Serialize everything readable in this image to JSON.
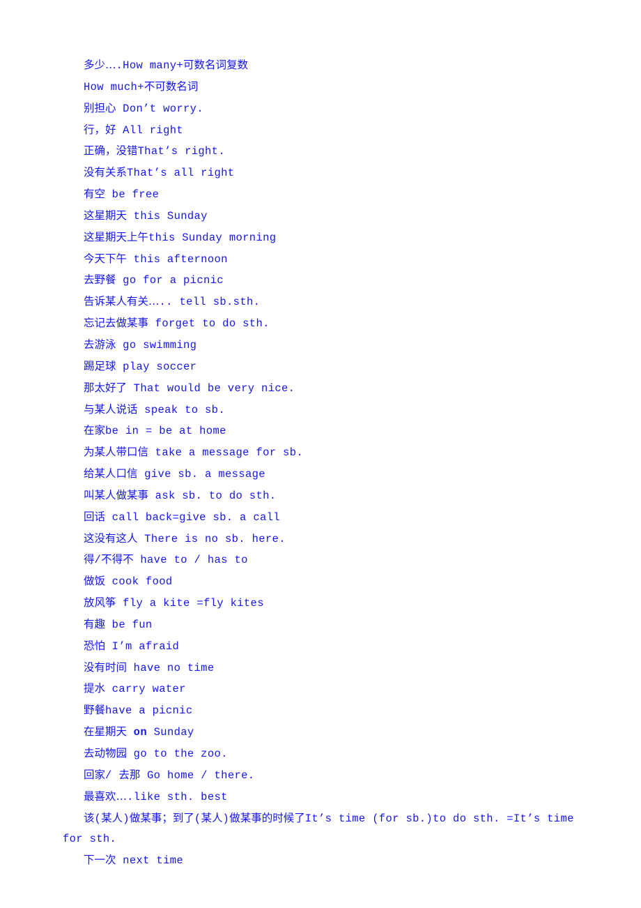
{
  "document": {
    "text_color": "#1616f0",
    "background_color": "#ffffff",
    "lines": [
      {
        "id": "line-1",
        "text": "多少….How many+可数名词复数",
        "indent": true
      },
      {
        "id": "line-2",
        "text": "How much+不可数名词",
        "indent": true
      },
      {
        "id": "line-3",
        "text": "别担心 Don’t worry.",
        "indent": true
      },
      {
        "id": "line-4",
        "text": "行，好  All right",
        "indent": true
      },
      {
        "id": "line-5",
        "text": "正确，没错That’s right.",
        "indent": true
      },
      {
        "id": "line-6",
        "text": "没有关系That’s all right",
        "indent": true
      },
      {
        "id": "line-7",
        "text": "有空  be free",
        "indent": true
      },
      {
        "id": "line-8",
        "text": "这星期天  this Sunday",
        "indent": true
      },
      {
        "id": "line-9",
        "text": "这星期天上午this Sunday morning",
        "indent": true
      },
      {
        "id": "line-10",
        "text": "今天下午 this afternoon",
        "indent": true
      },
      {
        "id": "line-11",
        "text": "去野餐  go for a picnic",
        "indent": true
      },
      {
        "id": "line-12",
        "text": "告诉某人有关….. tell sb.sth.",
        "indent": true
      },
      {
        "id": "line-13",
        "text": "忘记去做某事 forget to do sth.",
        "indent": true
      },
      {
        "id": "line-14",
        "text": "去游泳  go swimming",
        "indent": true
      },
      {
        "id": "line-15",
        "text": "踢足球 play soccer",
        "indent": true
      },
      {
        "id": "line-16",
        "text": "那太好了  That would be very nice.",
        "indent": true
      },
      {
        "id": "line-17",
        "text": "与某人说话  speak to sb.",
        "indent": true
      },
      {
        "id": "line-18",
        "text": "在家be in = be at home",
        "indent": true
      },
      {
        "id": "line-19",
        "text": "为某人带口信 take a message for sb.",
        "indent": true
      },
      {
        "id": "line-20",
        "text": "给某人口信  give sb. a message",
        "indent": true
      },
      {
        "id": "line-21",
        "text": "叫某人做某事 ask sb. to do sth.",
        "indent": true
      },
      {
        "id": "line-22",
        "text": "回话 call back=give sb. a call",
        "indent": true
      },
      {
        "id": "line-23",
        "text": "这没有这人 There is no sb. here.",
        "indent": true
      },
      {
        "id": "line-24",
        "text": "得/不得不 have to / has to",
        "indent": true
      },
      {
        "id": "line-25",
        "text": "做饭 cook food",
        "indent": true
      },
      {
        "id": "line-26",
        "text": "放风筝  fly a kite =fly kites",
        "indent": true
      },
      {
        "id": "line-27",
        "text": "有趣 be fun",
        "indent": true
      },
      {
        "id": "line-28",
        "text": "恐怕 I’m afraid",
        "indent": true
      },
      {
        "id": "line-29",
        "text": "没有时间  have no time",
        "indent": true
      },
      {
        "id": "line-30",
        "text": "提水 carry water",
        "indent": true
      },
      {
        "id": "line-31",
        "text": "野餐have a picnic",
        "indent": true
      },
      {
        "id": "line-32",
        "text": "在星期天 on Sunday",
        "indent": true,
        "bold_segment": "on"
      },
      {
        "id": "line-33",
        "text": "去动物园 go to the zoo.",
        "indent": true
      },
      {
        "id": "line-34",
        "text": "回家/ 去那  Go home / there.",
        "indent": true
      },
      {
        "id": "line-35",
        "text": "最喜欢….like sth. best",
        "indent": true
      },
      {
        "id": "line-36",
        "text": "该(某人)做某事；到了(某人)做某事的时候了It’s time (for sb.)to do sth. =It’s time for sth.",
        "indent": true
      },
      {
        "id": "line-37",
        "text": "下一次 next time",
        "indent": true
      }
    ]
  }
}
